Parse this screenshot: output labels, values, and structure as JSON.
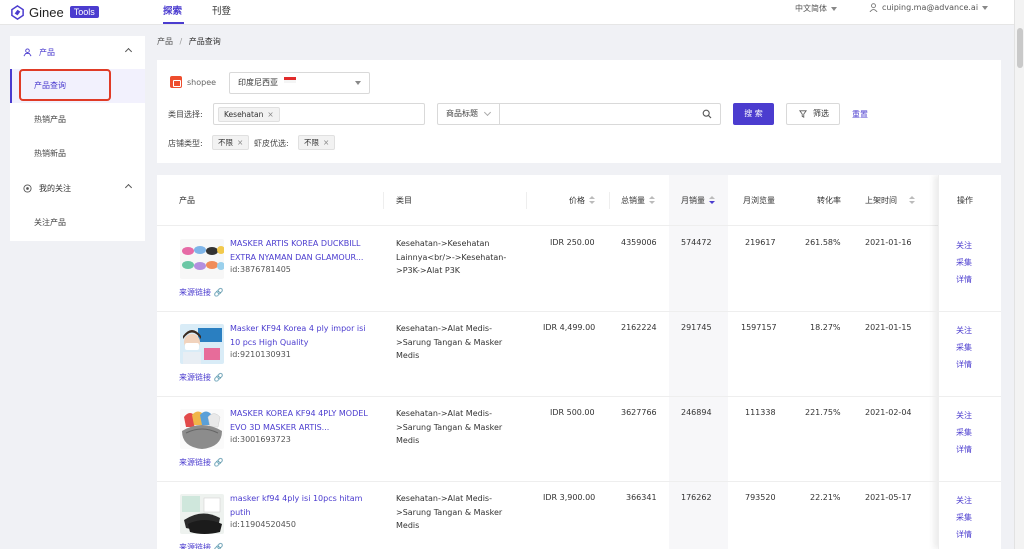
{
  "app": {
    "brand": "Ginee",
    "badge": "Tools"
  },
  "nav": {
    "tabs": [
      "探索",
      "刊登"
    ]
  },
  "header": {
    "language": "中文简体",
    "user_email": "cuiping.ma@advance.ai"
  },
  "sidebar": {
    "groups": [
      {
        "label": "产品",
        "items": [
          "产品查询",
          "热销产品",
          "热销新品"
        ]
      },
      {
        "label": "我的关注",
        "items": [
          "关注产品"
        ]
      }
    ]
  },
  "breadcrumb": {
    "parent": "产品",
    "separator": "/",
    "current": "产品查询"
  },
  "filters": {
    "platform": "shopee",
    "country": "印度尼西亚",
    "category_label": "类目选择:",
    "category_tag": "Kesehatan",
    "search_field": "商品标题",
    "search_button": "搜 索",
    "filter_button": "筛选",
    "reset_link": "重置",
    "shop_type_label": "店铺类型:",
    "shop_type_value": "不限",
    "shopee_preferred_label": "虾皮优选:",
    "shopee_preferred_value": "不限"
  },
  "table": {
    "columns": [
      "产品",
      "类目",
      "价格",
      "总销量",
      "月销量",
      "月浏览量",
      "转化率",
      "上架时间",
      "操作"
    ],
    "source_link": "来源链接",
    "actions": [
      "关注",
      "采集",
      "详情"
    ],
    "rows": [
      {
        "name": "MASKER ARTIS KOREA DUCKBILL EXTRA NYAMAN DAN GLAMOUR...",
        "id": "id:3876781405",
        "category": "Kesehatan->Kesehatan Lainnya<br/>->Kesehatan->P3K->Alat P3K",
        "price": "IDR 250.00",
        "total_sales": "4359006",
        "monthly_sales": "574472",
        "monthly_views": "219617",
        "conversion": "261.58%",
        "listed": "2021-01-16"
      },
      {
        "name": "Masker KF94 Korea 4 ply impor isi 10 pcs High Quality",
        "id": "id:9210130931",
        "category": "Kesehatan->Alat Medis->Sarung Tangan & Masker Medis",
        "price": "IDR 4,499.00",
        "total_sales": "2162224",
        "monthly_sales": "291745",
        "monthly_views": "1597157",
        "conversion": "18.27%",
        "listed": "2021-01-15"
      },
      {
        "name": "MASKER KOREA KF94 4PLY MODEL EVO 3D MASKER ARTIS...",
        "id": "id:3001693723",
        "category": "Kesehatan->Alat Medis->Sarung Tangan & Masker Medis",
        "price": "IDR 500.00",
        "total_sales": "3627766",
        "monthly_sales": "246894",
        "monthly_views": "111338",
        "conversion": "221.75%",
        "listed": "2021-02-04"
      },
      {
        "name": "masker kf94 4ply isi 10pcs hitam putih",
        "id": "id:11904520450",
        "category": "Kesehatan->Alat Medis->Sarung Tangan & Masker Medis",
        "price": "IDR 3,900.00",
        "total_sales": "366341",
        "monthly_sales": "176262",
        "monthly_views": "793520",
        "conversion": "22.21%",
        "listed": "2021-05-17"
      }
    ]
  },
  "thumbnail_icons": [
    "mask-colorful-icon",
    "mask-woman-icon",
    "mask-kf94-colors-icon",
    "mask-black-white-icon"
  ],
  "colors": {
    "accent": "#4b3ccf",
    "highlight": "#e03b26",
    "shopee": "#ee4d2d"
  }
}
